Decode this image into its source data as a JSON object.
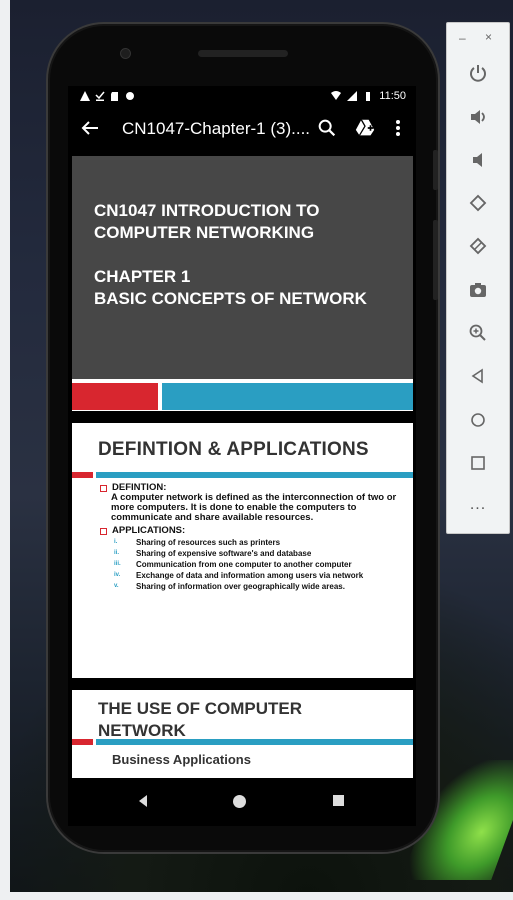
{
  "statusbar": {
    "time": "11:50"
  },
  "toolbar": {
    "title": "CN1047-Chapter-1 (3)...."
  },
  "slide1": {
    "title_line1": "CN1047 INTRODUCTION TO",
    "title_line2": "COMPUTER NETWORKING",
    "chapter_line1": "CHAPTER 1",
    "chapter_line2": "BASIC CONCEPTS OF NETWORK"
  },
  "slide2": {
    "title": "DEFINTION & APPLICATIONS",
    "definition_heading": "DEFINTION:",
    "definition_text": "A computer network is defined as the interconnection of two or more computers. It is done to enable the computers to communicate and share available resources.",
    "applications_heading": "APPLICATIONS:",
    "applications": [
      {
        "num": "i.",
        "text": "Sharing of resources such as printers"
      },
      {
        "num": "ii.",
        "text": "Sharing of expensive software's and database"
      },
      {
        "num": "iii.",
        "text": "Communication from one computer to another computer"
      },
      {
        "num": "iv.",
        "text": "Exchange of data and information among users via network"
      },
      {
        "num": "v.",
        "text": "Sharing of information over geographically wide areas."
      }
    ]
  },
  "slide3": {
    "title": "THE USE OF COMPUTER NETWORK",
    "next_heading": "Business Applications"
  },
  "emulator_panel": {
    "minimize_label": "–",
    "close_label": "×",
    "more_label": "..."
  },
  "colors": {
    "accent_red": "#d8262f",
    "accent_blue": "#2a9ec2",
    "slide_dark": "#474747"
  }
}
